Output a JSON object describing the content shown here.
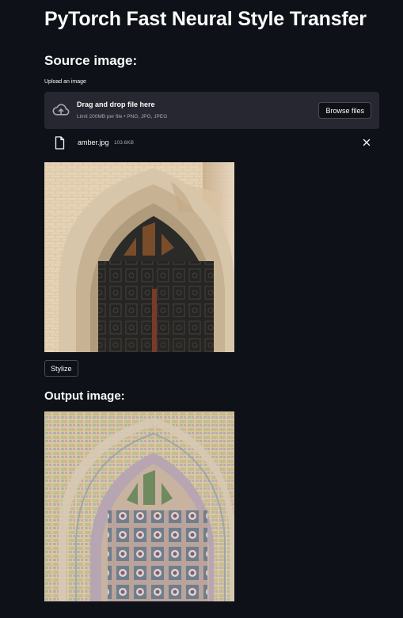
{
  "app": {
    "title": "PyTorch Fast Neural Style Transfer"
  },
  "source": {
    "heading": "Source image:",
    "upload_label": "Upload an image",
    "dropzone": {
      "main_text": "Drag and drop file here",
      "sub_text": "Limit 200MB per file • PNG, JPG, JPEG",
      "browse_label": "Browse files",
      "icon": "cloud-upload-icon"
    },
    "file": {
      "name": "amber.jpg",
      "size": "103.6KB",
      "icon": "file-icon",
      "remove_icon": "close-icon"
    },
    "image_description": "gothic stone archway with dark wooden doors"
  },
  "actions": {
    "stylize_label": "Stylize"
  },
  "output": {
    "heading": "Output image:",
    "image_description": "stylized mosaic version of the archway"
  },
  "colors": {
    "background": "#0e1117",
    "dropzone": "#262730",
    "text": "#fafafa",
    "muted_text": "#a3a8b8"
  }
}
